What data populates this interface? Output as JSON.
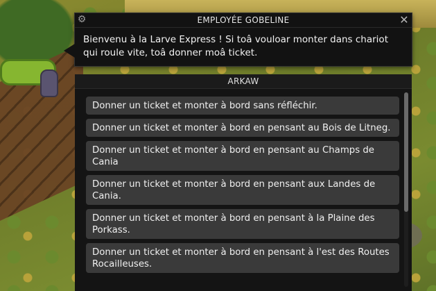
{
  "npc_dialog": {
    "title": "EMPLOYÉE GOBELINE",
    "message": "Bienvenu à la Larve Express ! Si toâ vouloar monter dans chariot qui roule vite, toâ donner moâ ticket.",
    "icons": {
      "settings": "gear-icon",
      "close": "close-icon"
    }
  },
  "reply_panel": {
    "title": "ARKAW",
    "scroll_position": 0,
    "options": [
      {
        "label": "Donner un ticket et monter à bord sans réfléchir."
      },
      {
        "label": "Donner un ticket et monter à bord en pensant au Bois de Litneg."
      },
      {
        "label": "Donner un ticket et monter à bord en pensant au Champs de Cania"
      },
      {
        "label": "Donner un ticket et monter à bord en pensant aux Landes de Cania."
      },
      {
        "label": "Donner un ticket et monter à bord en pensant à la Plaine des Porkass."
      },
      {
        "label": "Donner un ticket et monter à bord en pensant à l'est des Routes Rocailleuses."
      }
    ]
  },
  "colors": {
    "dialog_bg": "#121212",
    "option_bg": "#3a3a3a",
    "text": "#f2f2f2"
  }
}
